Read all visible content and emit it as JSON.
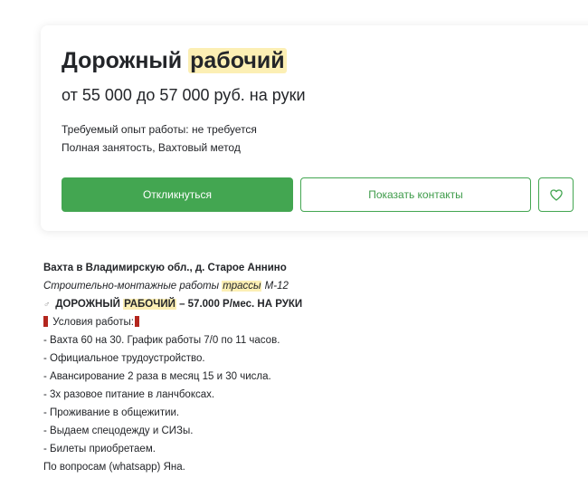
{
  "vacancy": {
    "title_main": "Дорожный ",
    "title_highlight": "рабочий",
    "salary": "от 55 000 до 57 000 руб. на руки",
    "experience": "Требуемый опыт работы: не требуется",
    "employment": "Полная занятость, Вахтовый метод",
    "respond_button": "Откликнуться",
    "contacts_button": "Показать контакты",
    "favorite_icon": "heart-icon"
  },
  "description": {
    "location": "Вахта в Владимирскую обл., д. Старое Аннино",
    "subtitle_part1": "Строительно-монтажные работы ",
    "subtitle_highlight": "трассы",
    "subtitle_part2": " М-12",
    "headline_icon": "♂",
    "headline_part1": " ДОРОЖНЫЙ ",
    "headline_highlight": "РАБОЧИЙ",
    "headline_part2": " – 57.000 Р/мес. НА РУКИ",
    "conditions_label": " Условия работы:",
    "items": [
      "- Вахта 60 на 30. График работы 7/0 по 11 часов.",
      "- Официальное трудоустройство.",
      "- Авансирование 2 раза в месяц 15 и 30 числа.",
      "- 3х разовое питание в ланчбоксах.",
      "- Проживание в общежитии.",
      "- Выдаем спецодежду и СИЗы.",
      "- Билеты приобретаем."
    ],
    "contact": "По вопросам (whatsapp) Яна."
  },
  "colors": {
    "accent_green": "#43a651",
    "highlight_yellow": "#fcefb4",
    "marker_red": "#b3261e",
    "text": "#232529"
  }
}
